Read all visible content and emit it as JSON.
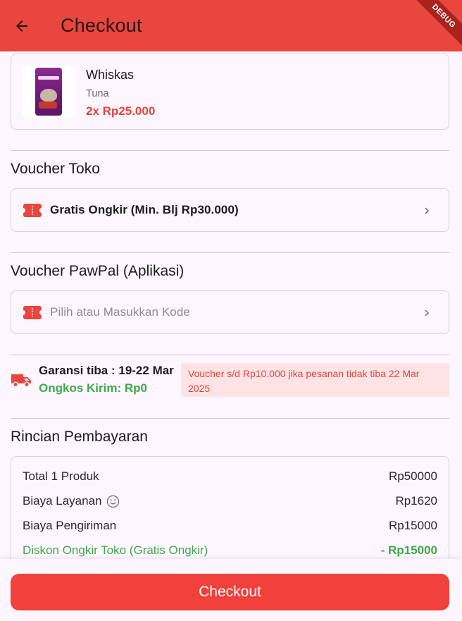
{
  "appbar": {
    "title": "Checkout",
    "debug_label": "DEBUG"
  },
  "product": {
    "name": "Whiskas",
    "variant": "Tuna",
    "price": "2x Rp25.000"
  },
  "voucher_toko": {
    "title": "Voucher Toko",
    "value": "Gratis Ongkir (Min. Blj Rp30.000)"
  },
  "voucher_app": {
    "title": "Voucher PawPal (Aplikasi)",
    "placeholder": "Pilih atau Masukkan Kode"
  },
  "shipping": {
    "guarantee": "Garansi tiba : 19-22 Mar",
    "cost": "Ongkos Kirim: Rp0",
    "note": "Voucher s/d Rp10.000 jika pesanan tidak tiba 22 Mar 2025"
  },
  "payment": {
    "title": "Rincian Pembayaran",
    "rows": [
      {
        "label": "Total 1 Produk",
        "value": "Rp50000"
      },
      {
        "label": "Biaya Layanan",
        "value": "Rp1620"
      },
      {
        "label": "Biaya Pengiriman",
        "value": "Rp15000"
      },
      {
        "label": "Diskon Ongkir Toko (Gratis Ongkir)",
        "value": "- Rp15000"
      }
    ]
  },
  "checkout_button": {
    "label": "Checkout"
  },
  "colors": {
    "primary": "#e8463e",
    "success": "#3fa94a",
    "background": "#fdf6ff"
  }
}
